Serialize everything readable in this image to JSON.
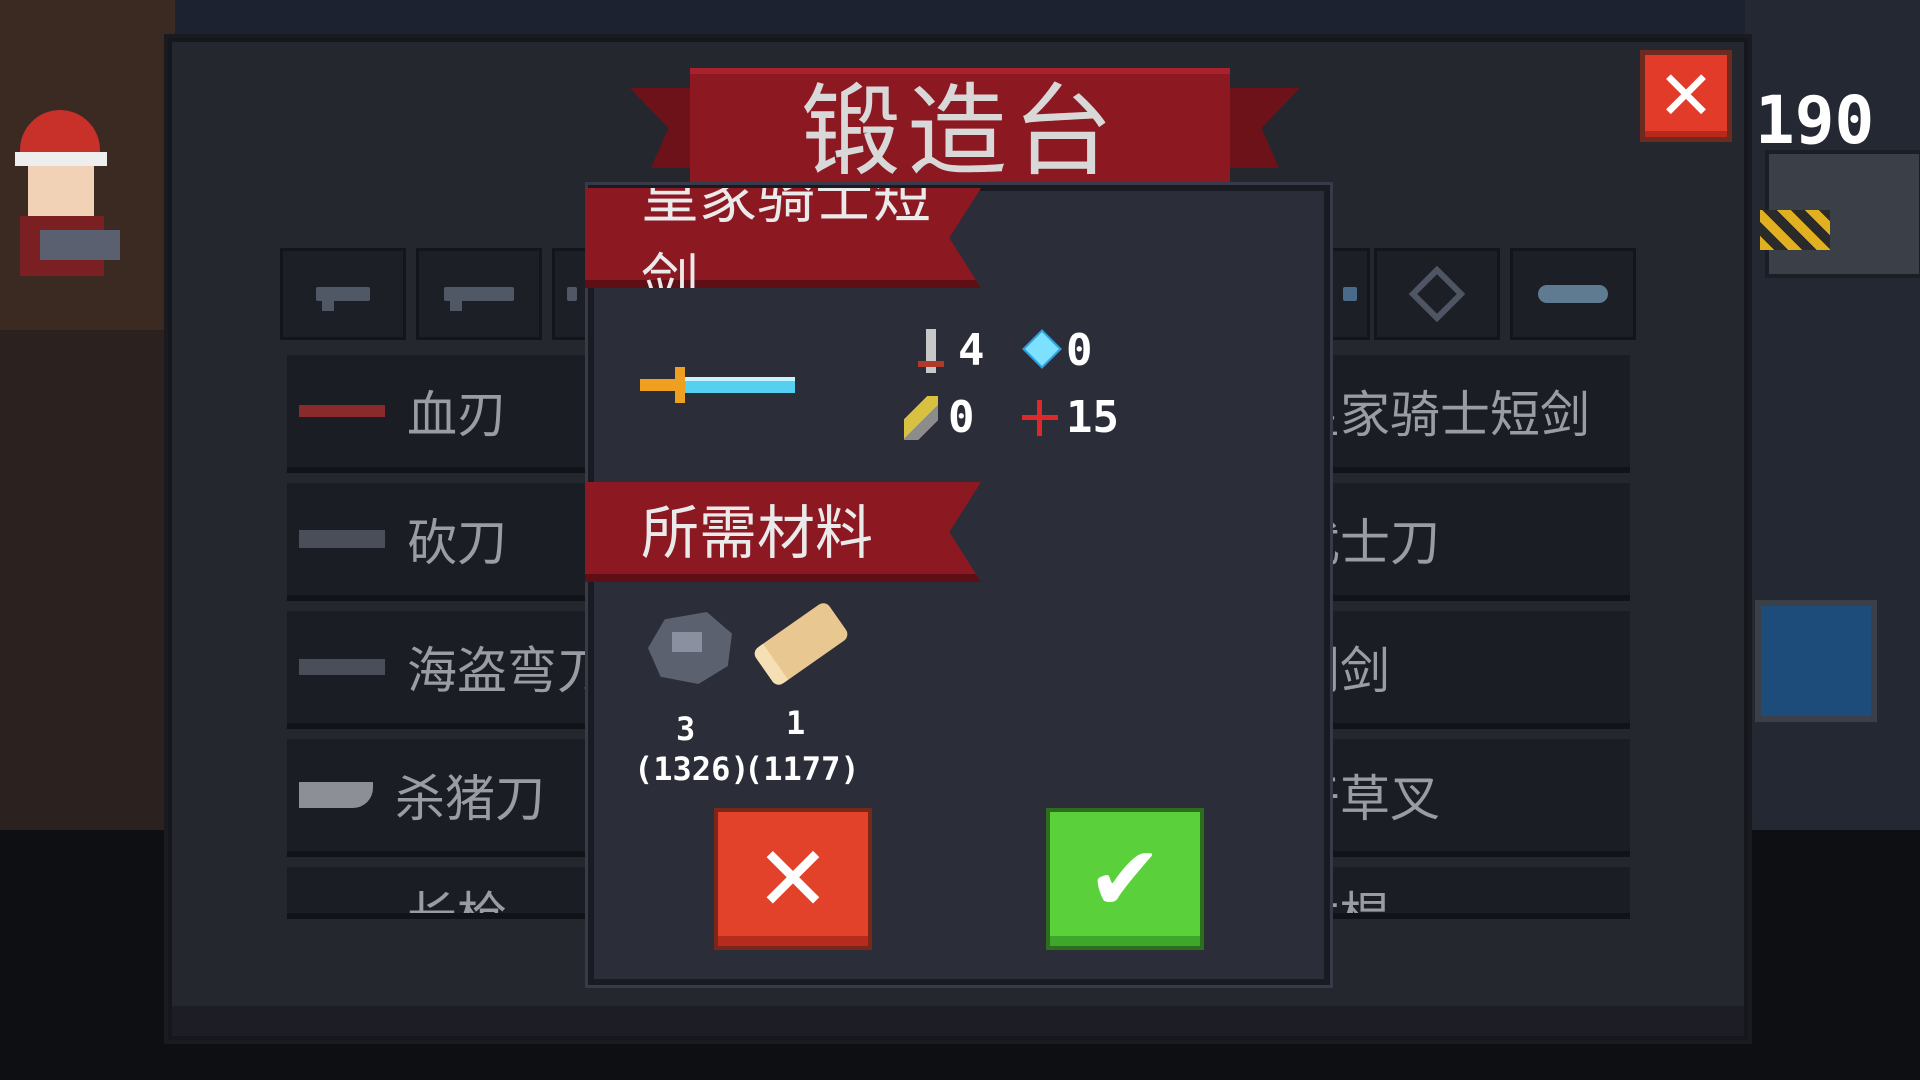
{
  "header": {
    "title": "锻造台",
    "close_symbol": "✕",
    "coin_count": "190"
  },
  "tabs": [
    {
      "icon": "pistol-icon"
    },
    {
      "icon": "rifle-icon"
    },
    {
      "icon": "weapon-icon"
    },
    {
      "icon": "blaster-icon"
    },
    {
      "icon": "diamond-icon"
    },
    {
      "icon": "fish-weapon-icon"
    }
  ],
  "list_left": [
    {
      "label": "血刃",
      "icon": "blood-blade-icon"
    },
    {
      "label": "砍刀",
      "icon": "machete-icon"
    },
    {
      "label": "海盗弯刀",
      "icon": "pirate-cutlass-icon"
    },
    {
      "label": "杀猪刀",
      "icon": "cleaver-icon"
    },
    {
      "label": "长枪",
      "icon": "spear-icon"
    }
  ],
  "list_right": [
    {
      "label": "皇家骑士短剑"
    },
    {
      "label": "武士刀"
    },
    {
      "label": "刺剑"
    },
    {
      "label": "干草叉"
    },
    {
      "label": "木棍"
    }
  ],
  "detail": {
    "weapon_name": "皇家骑士短剑",
    "weapon_icon": "royal-knight-sword-icon",
    "stats": {
      "attack": "4",
      "energy_cost": "0",
      "speed": "0",
      "critical": "15"
    },
    "materials_title": "所需材料",
    "materials": [
      {
        "icon": "iron-ore-icon",
        "required": "3",
        "owned": "(1326)"
      },
      {
        "icon": "wood-icon",
        "required": "1",
        "owned": "(1177)"
      }
    ],
    "cancel_symbol": "✕",
    "confirm_symbol": "✔"
  },
  "colors": {
    "banner_red": "#8c1822",
    "cancel_red": "#e2412a",
    "confirm_green": "#5ad03a",
    "gem_blue": "#7ee0ff"
  }
}
